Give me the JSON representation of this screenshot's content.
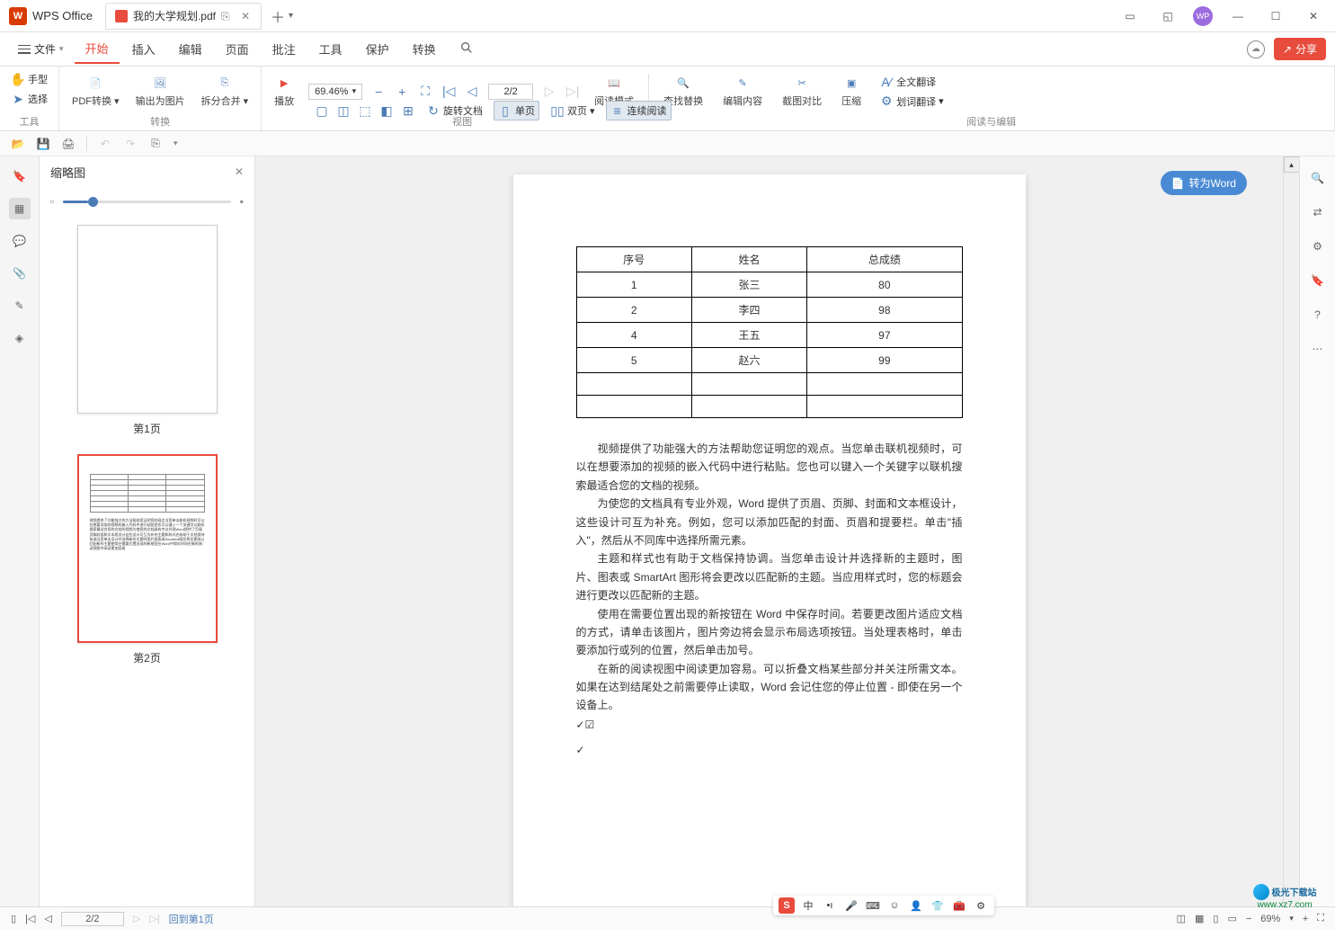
{
  "app": {
    "name": "WPS Office"
  },
  "tab": {
    "filename": "我的大学规划.pdf"
  },
  "file_menu": "文件",
  "menus": {
    "start": "开始",
    "insert": "插入",
    "edit": "编辑",
    "page": "页面",
    "annotate": "批注",
    "tools": "工具",
    "protect": "保护",
    "convert": "转换"
  },
  "share_btn": "分享",
  "ribbon": {
    "tools": {
      "hand": "手型",
      "select": "选择",
      "label": "工具"
    },
    "convert": {
      "pdf": "PDF转换",
      "image": "输出为图片",
      "split": "拆分合并",
      "label": "转换"
    },
    "play": "播放",
    "zoom": "69.46%",
    "page_input": "2/2",
    "rotate": "旋转文档",
    "single": "单页",
    "double": "双页",
    "continuous": "连续阅读",
    "read_mode": "阅读模式",
    "view_label": "视图",
    "find": "查找替换",
    "edit_content": "编辑内容",
    "screenshot": "截图对比",
    "compress": "压缩",
    "full_trans": "全文翻译",
    "word_trans": "划词翻译",
    "read_edit_label": "阅读与编辑"
  },
  "thumbnail": {
    "title": "缩略图",
    "page1": "第1页",
    "page2": "第2页"
  },
  "convert_word": "转为Word",
  "document": {
    "table": {
      "headers": [
        "序号",
        "姓名",
        "总成绩"
      ],
      "rows": [
        [
          "1",
          "张三",
          "80"
        ],
        [
          "2",
          "李四",
          "98"
        ],
        [
          "4",
          "王五",
          "97"
        ],
        [
          "5",
          "赵六",
          "99"
        ],
        [
          "",
          "",
          ""
        ],
        [
          "",
          "",
          ""
        ]
      ]
    },
    "paragraphs": [
      "视频提供了功能强大的方法帮助您证明您的观点。当您单击联机视频时，可以在想要添加的视频的嵌入代码中进行粘贴。您也可以键入一个关键字以联机搜索最适合您的文档的视频。",
      "为使您的文档具有专业外观，Word 提供了页眉、页脚、封面和文本框设计，这些设计可互为补充。例如，您可以添加匹配的封面、页眉和提要栏。单击\"插入\"，然后从不同库中选择所需元素。",
      "主题和样式也有助于文档保持协调。当您单击设计并选择新的主题时，图片、图表或 SmartArt 图形将会更改以匹配新的主题。当应用样式时，您的标题会进行更改以匹配新的主题。",
      "使用在需要位置出现的新按钮在 Word 中保存时间。若要更改图片适应文档的方式，请单击该图片，图片旁边将会显示布局选项按钮。当处理表格时，单击要添加行或列的位置，然后单击加号。",
      "在新的阅读视图中阅读更加容易。可以折叠文档某些部分并关注所需文本。如果在达到结尾处之前需要停止读取，Word 会记住您的停止位置 - 即使在另一个设备上。"
    ],
    "check": "✓☑",
    "check2": "✓"
  },
  "status": {
    "page": "2/2",
    "back_page1": "回到第1页",
    "zoom": "69%"
  },
  "ime": {
    "lang": "中",
    "punct": "，",
    "full": "。"
  },
  "watermark": {
    "site": "极光下载站",
    "url": "www.xz7.com"
  }
}
